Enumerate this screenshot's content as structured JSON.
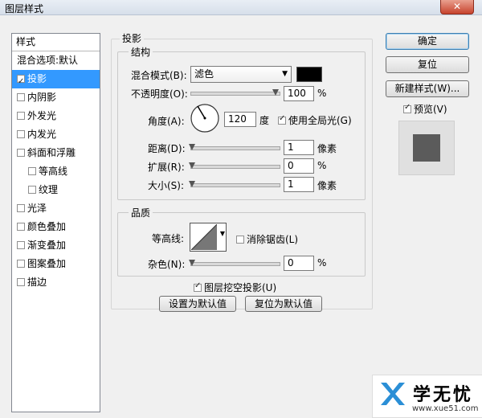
{
  "window": {
    "title": "图层样式",
    "close_glyph": "✕"
  },
  "styles_panel": {
    "header": "样式",
    "items": [
      {
        "label": "混合选项:默认",
        "checkbox": false,
        "checked": false
      },
      {
        "label": "投影",
        "checkbox": true,
        "checked": true,
        "selected": true
      },
      {
        "label": "内阴影",
        "checkbox": true,
        "checked": false
      },
      {
        "label": "外发光",
        "checkbox": true,
        "checked": false
      },
      {
        "label": "内发光",
        "checkbox": true,
        "checked": false
      },
      {
        "label": "斜面和浮雕",
        "checkbox": true,
        "checked": false
      },
      {
        "label": "等高线",
        "checkbox": true,
        "checked": false,
        "indent": true
      },
      {
        "label": "纹理",
        "checkbox": true,
        "checked": false,
        "indent": true
      },
      {
        "label": "光泽",
        "checkbox": true,
        "checked": false
      },
      {
        "label": "颜色叠加",
        "checkbox": true,
        "checked": false
      },
      {
        "label": "渐变叠加",
        "checkbox": true,
        "checked": false
      },
      {
        "label": "图案叠加",
        "checkbox": true,
        "checked": false
      },
      {
        "label": "描边",
        "checkbox": true,
        "checked": false
      }
    ]
  },
  "drop_shadow": {
    "title": "投影",
    "structure": {
      "title": "结构",
      "blend_mode_label": "混合模式(B):",
      "blend_mode_value": "滤色",
      "shadow_color": "#000000",
      "opacity_label": "不透明度(O):",
      "opacity_value": "100",
      "opacity_unit": "%",
      "angle_label": "角度(A):",
      "angle_value": "120",
      "angle_unit": "度",
      "global_light_label": "使用全局光(G)",
      "global_light_checked": true,
      "distance_label": "距离(D):",
      "distance_value": "1",
      "distance_unit": "像素",
      "spread_label": "扩展(R):",
      "spread_value": "0",
      "spread_unit": "%",
      "size_label": "大小(S):",
      "size_value": "1",
      "size_unit": "像素"
    },
    "quality": {
      "title": "品质",
      "contour_label": "等高线:",
      "antialias_label": "消除锯齿(L)",
      "antialias_checked": false,
      "noise_label": "杂色(N):",
      "noise_value": "0",
      "noise_unit": "%"
    },
    "knockout_label": "图层挖空投影(U)",
    "knockout_checked": true,
    "make_default_label": "设置为默认值",
    "reset_default_label": "复位为默认值"
  },
  "actions": {
    "ok_label": "确定",
    "reset_label": "复位",
    "new_style_label": "新建样式(W)...",
    "preview_label": "预览(V)",
    "preview_checked": true
  },
  "watermark": {
    "brand": "学无忧",
    "url": "www.xue51.com"
  }
}
